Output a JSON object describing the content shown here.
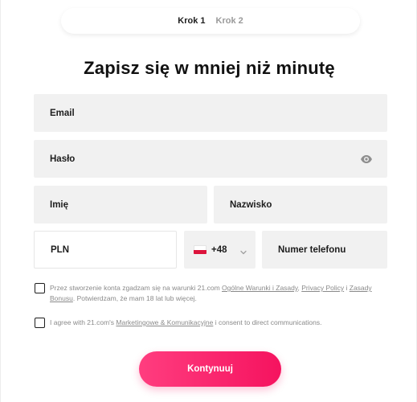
{
  "steps": {
    "step1": "Krok 1",
    "step2": "Krok 2",
    "active": "step1"
  },
  "title": "Zapisz się w mniej niż minutę",
  "fields": {
    "email_placeholder": "Email",
    "password_placeholder": "Hasło",
    "first_name_placeholder": "Imię",
    "last_name_placeholder": "Nazwisko",
    "currency_value": "PLN",
    "phone_prefix": "+48",
    "phone_placeholder": "Numer telefonu",
    "password_toggle_icon": "eye-icon",
    "phone_prefix_flag_icon": "poland-flag-icon",
    "phone_prefix_dropdown_icon": "chevron-down-icon"
  },
  "consents": {
    "terms": {
      "checked": false,
      "text_1": "Przez stworzenie konta zgadzam się na warunki 21.com ",
      "link_terms": "Ogólne Warunki i Zasady",
      "text_2": ", ",
      "link_privacy": "Privacy Policy",
      "text_3": " i ",
      "link_bonus": "Zasady Bonusu",
      "text_4": ". Potwierdzam, że mam 18 lat lub więcej."
    },
    "marketing": {
      "checked": false,
      "text_1": "I agree with 21.com's ",
      "link_marketing": "Marketingowe & Komunikacyjne",
      "text_2": " i consent to direct communications."
    }
  },
  "cta_label": "Kontynuuj",
  "colors": {
    "accent_start": "#ff3d7f",
    "accent_end": "#f5135f",
    "field_bg": "#f1f1f1",
    "title_text": "#111111",
    "muted_text": "#8a8a8a"
  }
}
